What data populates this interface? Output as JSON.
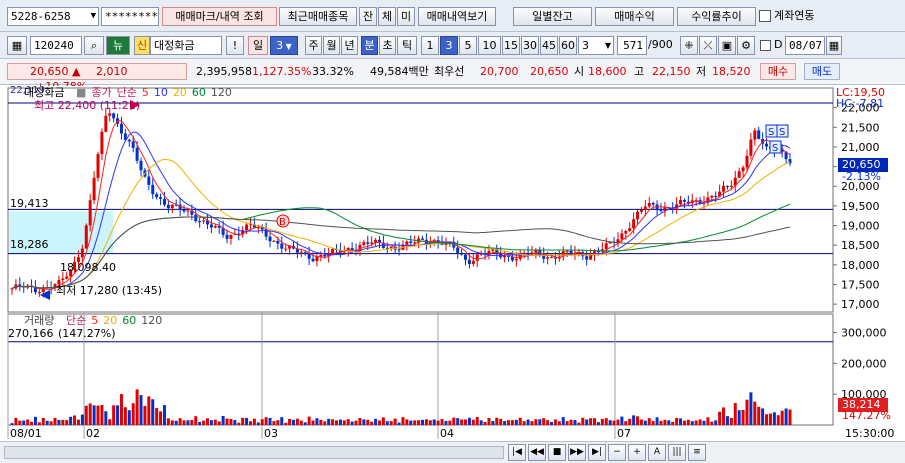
{
  "toolbar1": {
    "account": "5228-6258",
    "password": "********",
    "btn_trade": "매매마크/내역 조회",
    "btn_recent": "최근매매종목",
    "btn_jan": "잔",
    "btn_che": "체",
    "btn_mi": "미",
    "btn_history": "매매내역보기",
    "btn_daily": "일별잔고",
    "btn_profit": "매매수익",
    "btn_return": "수익률추이",
    "chk_link": "계좌연동"
  },
  "toolbar2": {
    "code": "120240",
    "badge1": "뉴",
    "badge2": "신",
    "stock_name": "대정화금",
    "btn_excl": "!",
    "period_il": "일",
    "period_num": "3",
    "p_ju": "주",
    "p_wol": "월",
    "p_nyeon": "년",
    "p_bun": "분",
    "p_cho": "초",
    "p_tik": "틱",
    "minutes": [
      "1",
      "3",
      "5",
      "10",
      "15",
      "30",
      "45",
      "60"
    ],
    "active_minute": "3",
    "min_select": "3",
    "count": "571",
    "count_total": "/900",
    "check_d": "D",
    "date": "08/07"
  },
  "quote": {
    "price": "20,650",
    "change_sign": "▲",
    "change": "2,010",
    "change_pct": "+10.78%",
    "volume": "2,395,958",
    "vol_ratio": "1,127.35%",
    "turnover": "33.32%",
    "amount": "49,584백만",
    "best_bid_label": "최우선",
    "best_ask": "20,700",
    "best_bid": "20,650",
    "open_label": "시",
    "open": "18,600",
    "high_label": "고",
    "high": "22,150",
    "low_label": "저",
    "low": "18,520",
    "buy_btn": "매수",
    "sell_btn": "매도"
  },
  "price_panel": {
    "title": "대정화금",
    "legend_close": "종가",
    "legend_ma": "단순",
    "ma_periods": [
      "5",
      "10",
      "20",
      "60",
      "120"
    ],
    "ma_colors": [
      "#ff2020",
      "#3030ff",
      "#f0b000",
      "#008a30",
      "#505050"
    ],
    "left_top_value": "22,119",
    "high_marker": "최고 22,400 (11:21)",
    "low_marker": "최저 17,280 (13:45)",
    "level_upper": "19,413",
    "level_lower": "18,286",
    "level_low_label": "18,098.40",
    "lc_label": "LC:19,50",
    "hc_label": "HC:-7.81",
    "current_price": "20,650",
    "current_pct": "-2.13%",
    "buy_marker": "B",
    "sell_marker": "S",
    "y_ticks": [
      "22,000",
      "21,500",
      "21,000",
      "20,500",
      "20,000",
      "19,500",
      "19,000",
      "18,500",
      "18,000",
      "17,500",
      "17,000"
    ]
  },
  "volume_panel": {
    "title": "거래량",
    "legend_ma": "단순",
    "ma_periods": [
      "5",
      "20",
      "60",
      "120"
    ],
    "ma_colors": [
      "#ff2020",
      "#f0b000",
      "#008a30",
      "#505050"
    ],
    "left_value": "270,166",
    "ratio": "(147.27%)",
    "current_volume": "38,214",
    "current_ratio": "147.27%",
    "y_ticks": [
      "300,000",
      "200,000",
      "100,000"
    ]
  },
  "x_axis": {
    "labels": [
      "08/01",
      "02",
      "03",
      "04",
      "07"
    ],
    "time": "15:30:00"
  },
  "nav": {
    "buttons": [
      "|◀",
      "◀◀",
      "■",
      "▶▶",
      "▶|",
      "−",
      "+",
      "A",
      "|||",
      "≡"
    ]
  },
  "chart_data": {
    "type": "candlestick",
    "price_axis_range": [
      16800,
      22500
    ],
    "volume_axis_range": [
      0,
      360000
    ],
    "reference_lines": [
      22119,
      19413,
      18286
    ],
    "x_axis_labels": [
      "08/01",
      "02",
      "03",
      "04",
      "07"
    ],
    "close_path_shape": [
      17400,
      17420,
      17380,
      17450,
      17500,
      17900,
      18600,
      20500,
      22000,
      21500,
      21000,
      20200,
      19800,
      19500,
      19400,
      19300,
      19100,
      18900,
      18700,
      18900,
      19000,
      18800,
      18600,
      18400,
      18300,
      18200,
      18250,
      18300,
      18400,
      18500,
      18550,
      18500,
      18450,
      18500,
      18600,
      18650,
      18550,
      18400,
      18100,
      18250,
      18300,
      18250,
      18200,
      18250,
      18300,
      18200,
      18250,
      18300,
      18250,
      18350,
      18500,
      18800,
      19200,
      19500,
      19450,
      19500,
      19550,
      19600,
      19700,
      19800,
      20000,
      20500,
      21400,
      20900,
      21000,
      20650
    ]
  }
}
